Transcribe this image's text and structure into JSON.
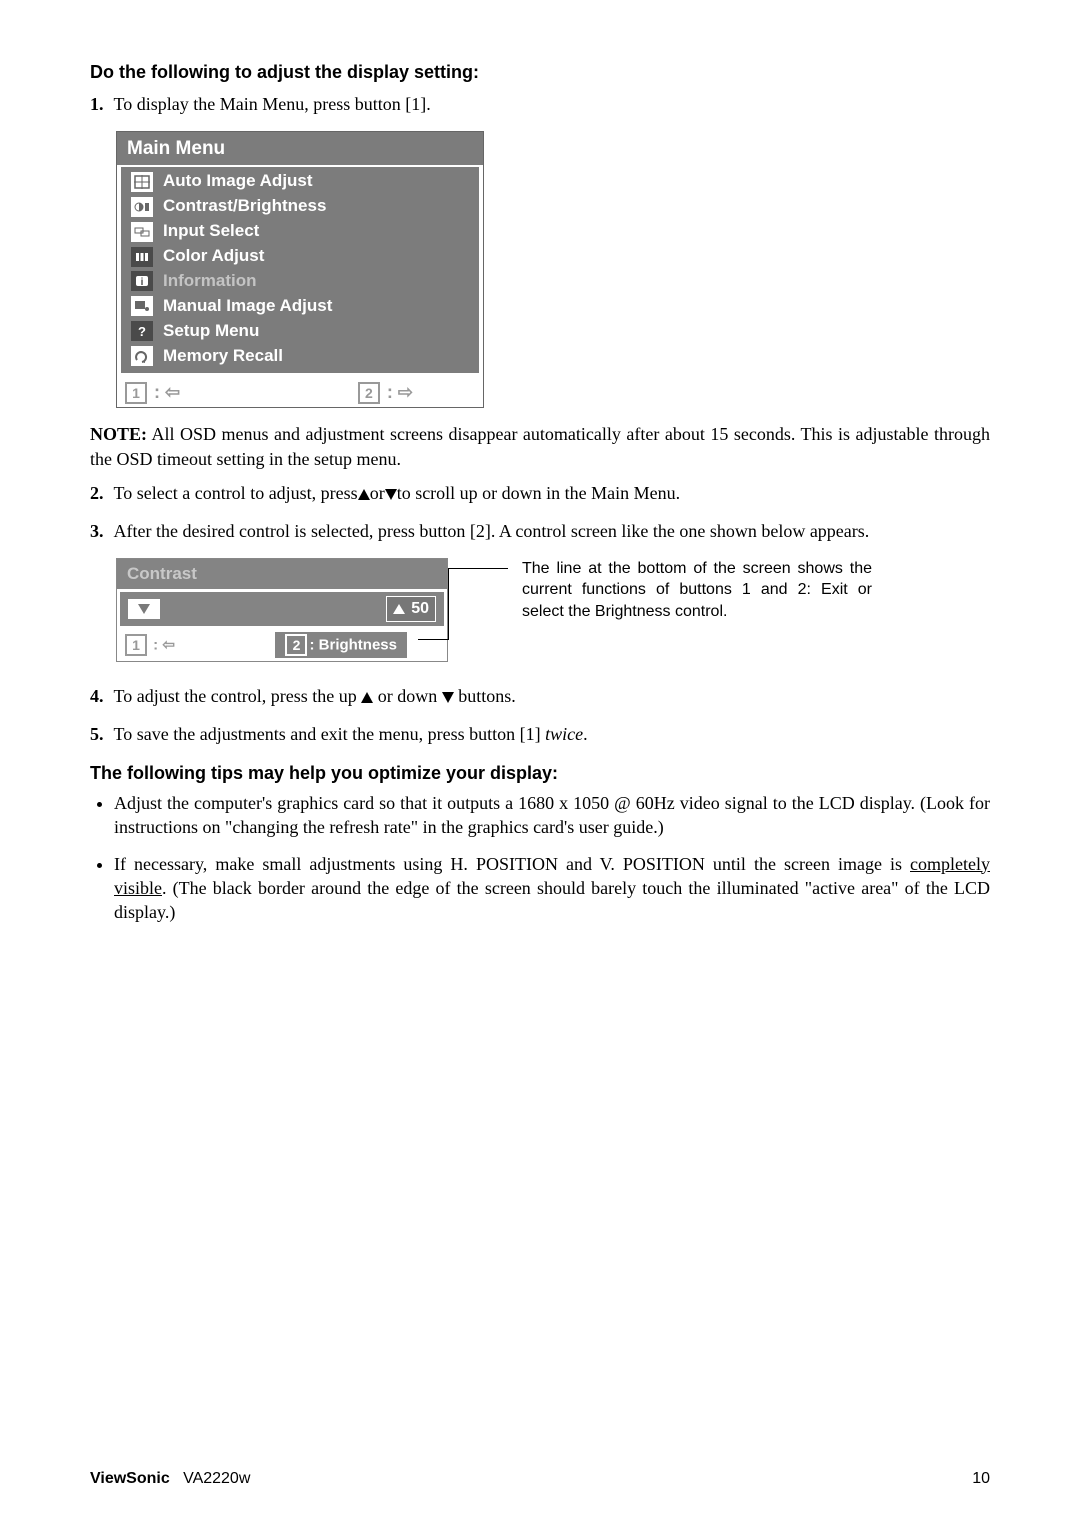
{
  "h1": "Do the following to adjust the display setting:",
  "step1": {
    "n": "1.",
    "text": "To display the Main Menu, press button [1]."
  },
  "menu": {
    "title": "Main Menu",
    "items": [
      "Auto Image Adjust",
      "Contrast/Brightness",
      "Input Select",
      "Color Adjust",
      "Information",
      "Manual Image Adjust",
      "Setup Menu",
      "Memory Recall"
    ],
    "foot1": "1",
    "foot2": "2"
  },
  "noteLabel": "NOTE:",
  "noteText": " All OSD menus and adjustment screens disappear automatically after about 15 seconds. This is adjustable through the OSD timeout setting in the setup menu.",
  "step2": {
    "n": "2.",
    "pre": "To select a control to adjust, press",
    "mid": "or",
    "post": "to scroll up or down in the Main Menu."
  },
  "step3": {
    "n": "3.",
    "text": "After the desired control is selected, press button [2]. A control screen like the one shown below appears."
  },
  "contrast": {
    "title": "Contrast",
    "value": "50",
    "foot1": "1",
    "brightLabel": ": Brightness",
    "brightKey": "2"
  },
  "callout": "The line at the bottom of the screen shows the current functions of buttons 1 and 2: Exit or select the Brightness control.",
  "step4": {
    "n": "4.",
    "pre": "To adjust the control, press the up ",
    "mid": " or down ",
    "post": " buttons."
  },
  "step5": {
    "n": "5.",
    "pre": "To save the adjustments and exit the menu, press button [1] ",
    "ital": "twice",
    "post": "."
  },
  "h2": "The following tips may help you optimize your display:",
  "tip1": "Adjust the computer's graphics card so that it outputs a 1680 x 1050 @ 60Hz video signal to the LCD display. (Look for instructions on \"changing the refresh rate\" in the graphics card's user guide.)",
  "tip2a": "If necessary, make small adjustments using H. POSITION and V. POSITION until the screen image is ",
  "tip2u": "completely visible",
  "tip2b": ". (The black border around the edge of the screen should barely touch the illuminated \"active area\" of the LCD display.)",
  "footer": {
    "brand": "ViewSonic",
    "model": "VA2220w",
    "page": "10"
  }
}
